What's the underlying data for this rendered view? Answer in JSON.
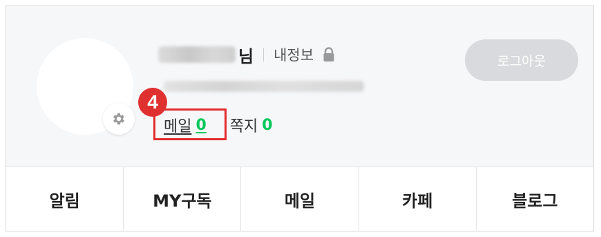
{
  "profile": {
    "name_suffix": "님",
    "my_info_label": "내정보",
    "mail_label": "메일",
    "mail_count": "0",
    "note_label": "쪽지",
    "note_count": "0",
    "logout_label": "로그아웃",
    "step_badge": "4"
  },
  "tabs": [
    {
      "label": "알림"
    },
    {
      "label": "MY구독"
    },
    {
      "label": "메일"
    },
    {
      "label": "카페"
    },
    {
      "label": "블로그"
    }
  ],
  "colors": {
    "count_green": "#03c75a",
    "highlight_red": "#e32b2b",
    "badge_red": "#e03131"
  }
}
